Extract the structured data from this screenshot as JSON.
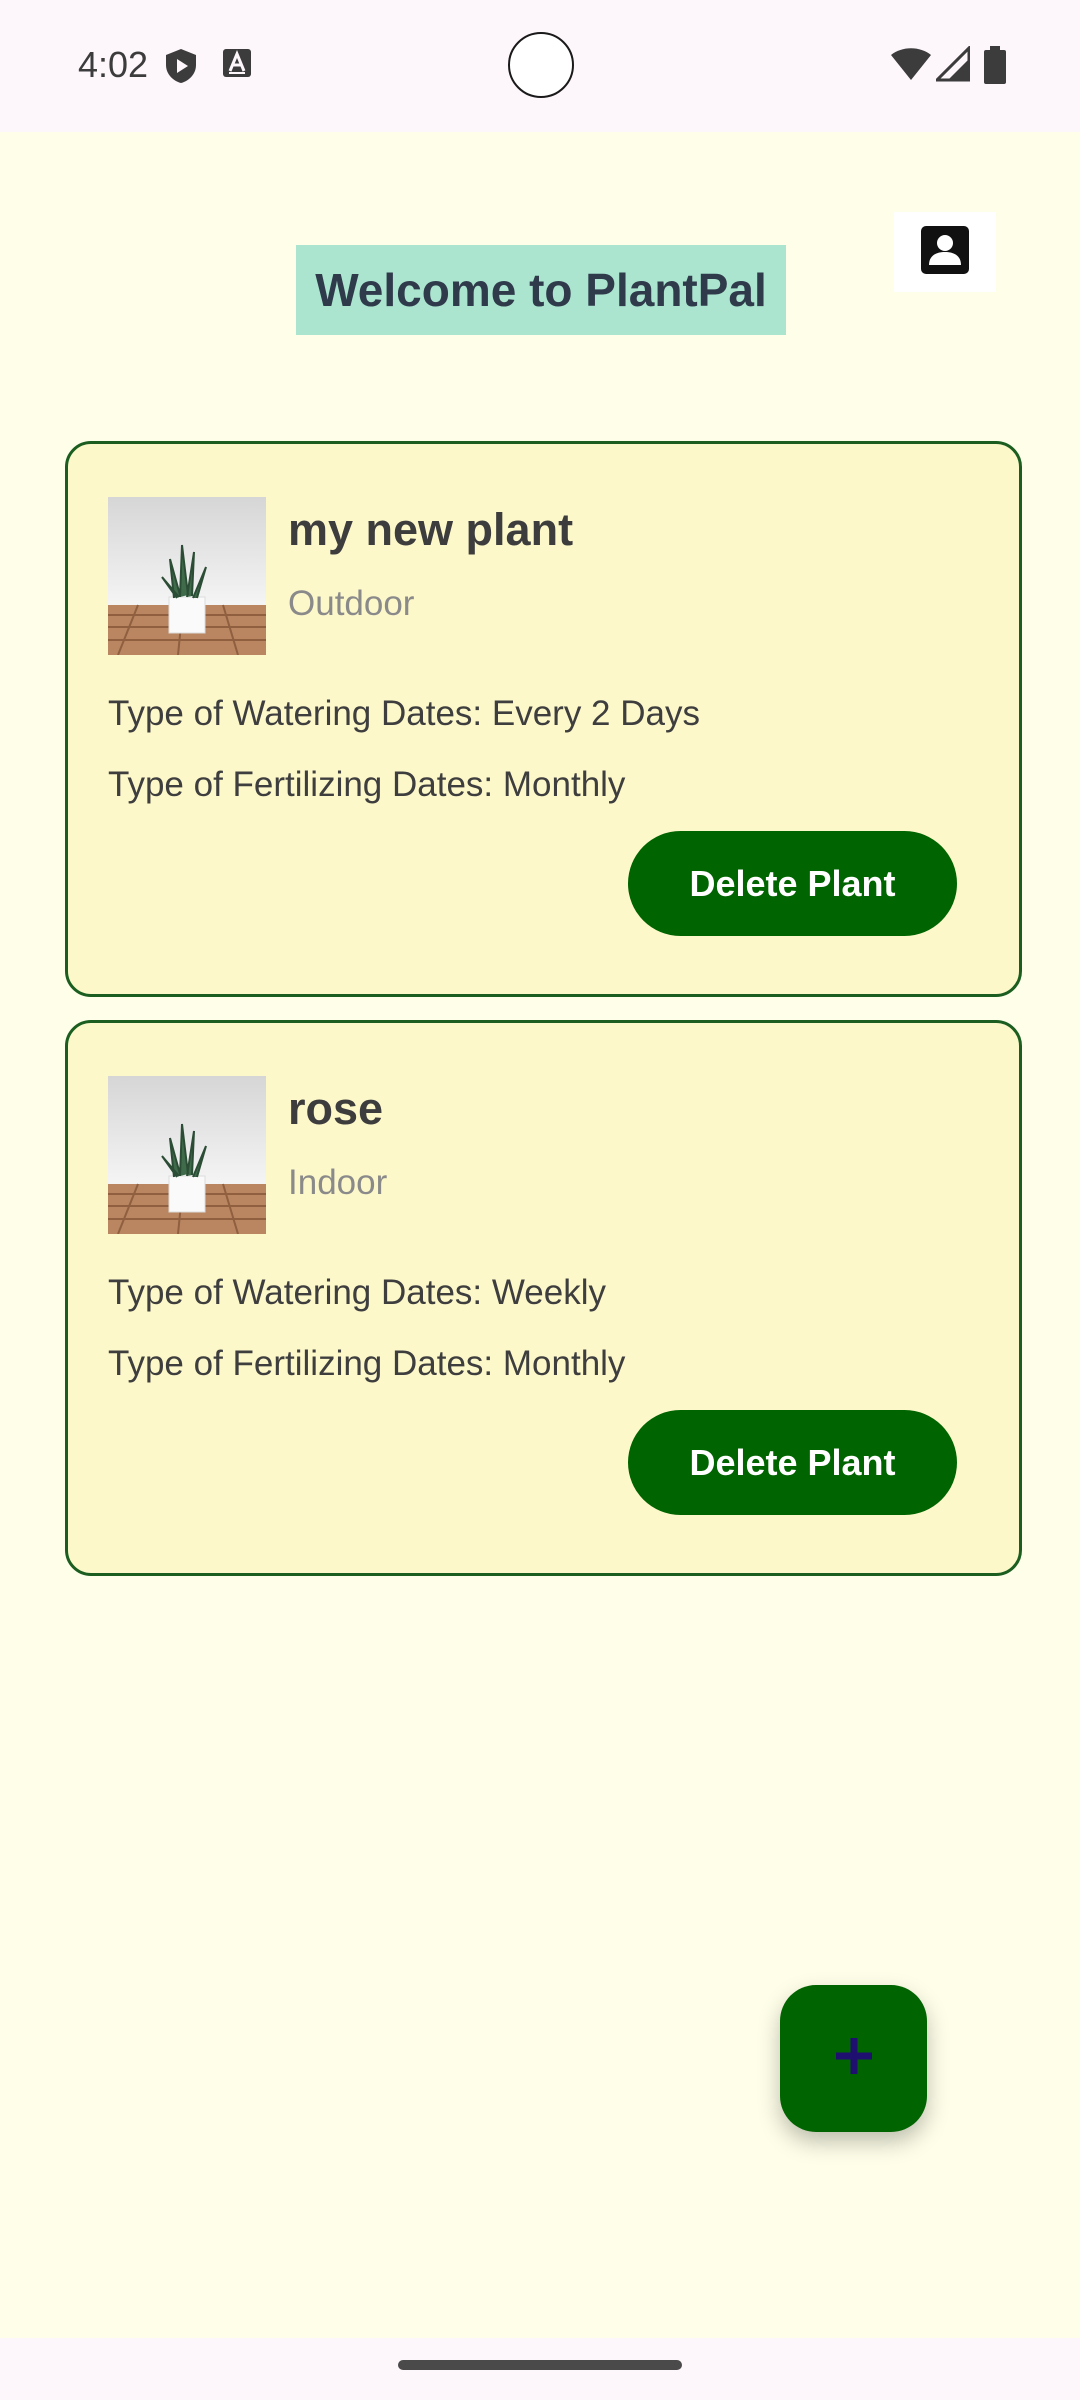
{
  "status_bar": {
    "time": "4:02",
    "left_icons": [
      "shield-play-icon",
      "font-a-icon"
    ],
    "right_icons": [
      "wifi-icon",
      "cell-signal-icon",
      "battery-icon"
    ]
  },
  "header": {
    "welcome_title": "Welcome to PlantPal",
    "profile_icon": "contact-card-icon"
  },
  "plants": [
    {
      "name": "my new plant",
      "location": "Outdoor",
      "watering": "Type of Watering Dates: Every 2 Days",
      "fertilizing": "Type of Fertilizing Dates: Monthly",
      "delete_label": "Delete Plant"
    },
    {
      "name": "rose",
      "location": "Indoor",
      "watering": "Type of Watering Dates: Weekly",
      "fertilizing": "Type of Fertilizing Dates: Monthly",
      "delete_label": "Delete Plant"
    }
  ],
  "fab": {
    "icon": "plus-icon"
  },
  "colors": {
    "background": "#fefee9",
    "card_background": "#fdf8ca",
    "card_border": "#1b5e20",
    "button_green": "#006400",
    "title_highlight": "#abe5cf",
    "fab_plus": "#1f0f6e"
  }
}
